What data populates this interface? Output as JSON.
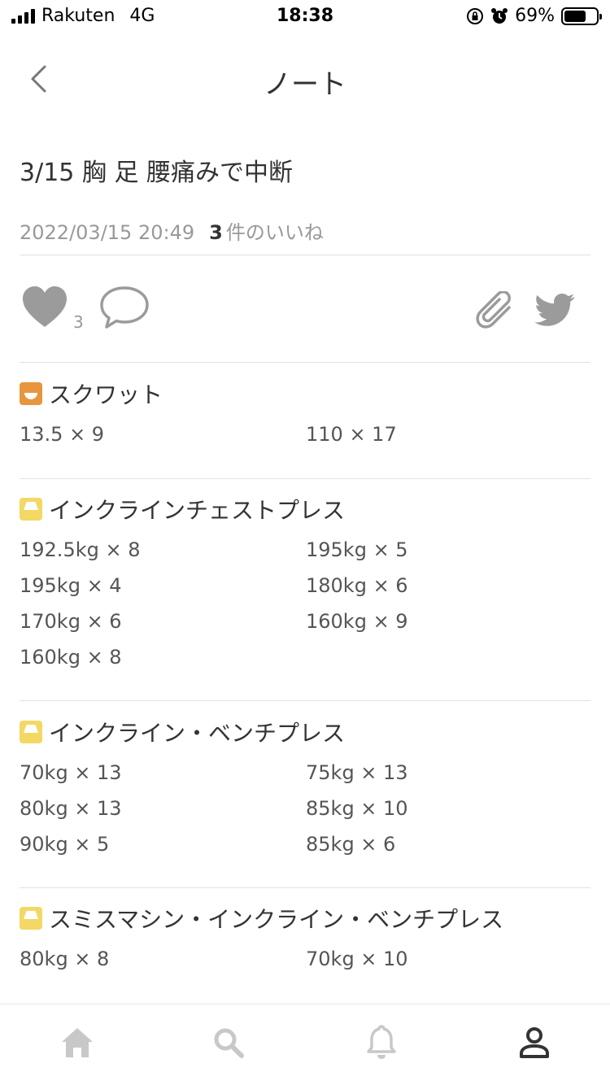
{
  "status": {
    "carrier": "Rakuten",
    "network": "4G",
    "time": "18:38",
    "battery_percent": "69%",
    "battery_level": 0.69
  },
  "nav": {
    "back_icon": "chevron-left-icon",
    "title": "ノート"
  },
  "note": {
    "title": "3/15 胸 足 腰痛みで中断",
    "date": "2022/03/15 20:49",
    "likes_number": "3",
    "likes_suffix": "件のいいね"
  },
  "actions": {
    "like_count": "3",
    "icons": [
      "heart-icon",
      "comment-icon",
      "paperclip-icon",
      "twitter-icon"
    ],
    "icon_color": "#9b9b9b"
  },
  "exercises": [
    {
      "name": "スクワット",
      "icon": "leg-category-icon",
      "icon_color": "#e8963e",
      "sets": [
        "13.5 × 9",
        "110 × 17"
      ]
    },
    {
      "name": "インクラインチェストプレス",
      "icon": "chest-category-icon",
      "icon_color": "#f3d865",
      "sets": [
        "192.5kg × 8",
        "195kg × 5",
        "195kg × 4",
        "180kg × 6",
        "170kg × 6",
        "160kg × 9",
        "160kg × 8"
      ]
    },
    {
      "name": "インクライン・ベンチプレス",
      "icon": "chest-category-icon",
      "icon_color": "#f3d865",
      "sets": [
        "70kg × 13",
        "75kg × 13",
        "80kg × 13",
        "85kg × 10",
        "90kg × 5",
        "85kg × 6"
      ]
    },
    {
      "name": "スミスマシン・インクライン・ベンチプレス",
      "icon": "chest-category-icon",
      "icon_color": "#f3d865",
      "sets": [
        "80kg × 8",
        "70kg × 10"
      ]
    }
  ],
  "tabbar": {
    "items": [
      "home-icon",
      "search-icon",
      "bell-icon",
      "user-icon"
    ],
    "active": "user-icon",
    "inactive_color": "#c8c8c8",
    "active_color": "#333333"
  }
}
